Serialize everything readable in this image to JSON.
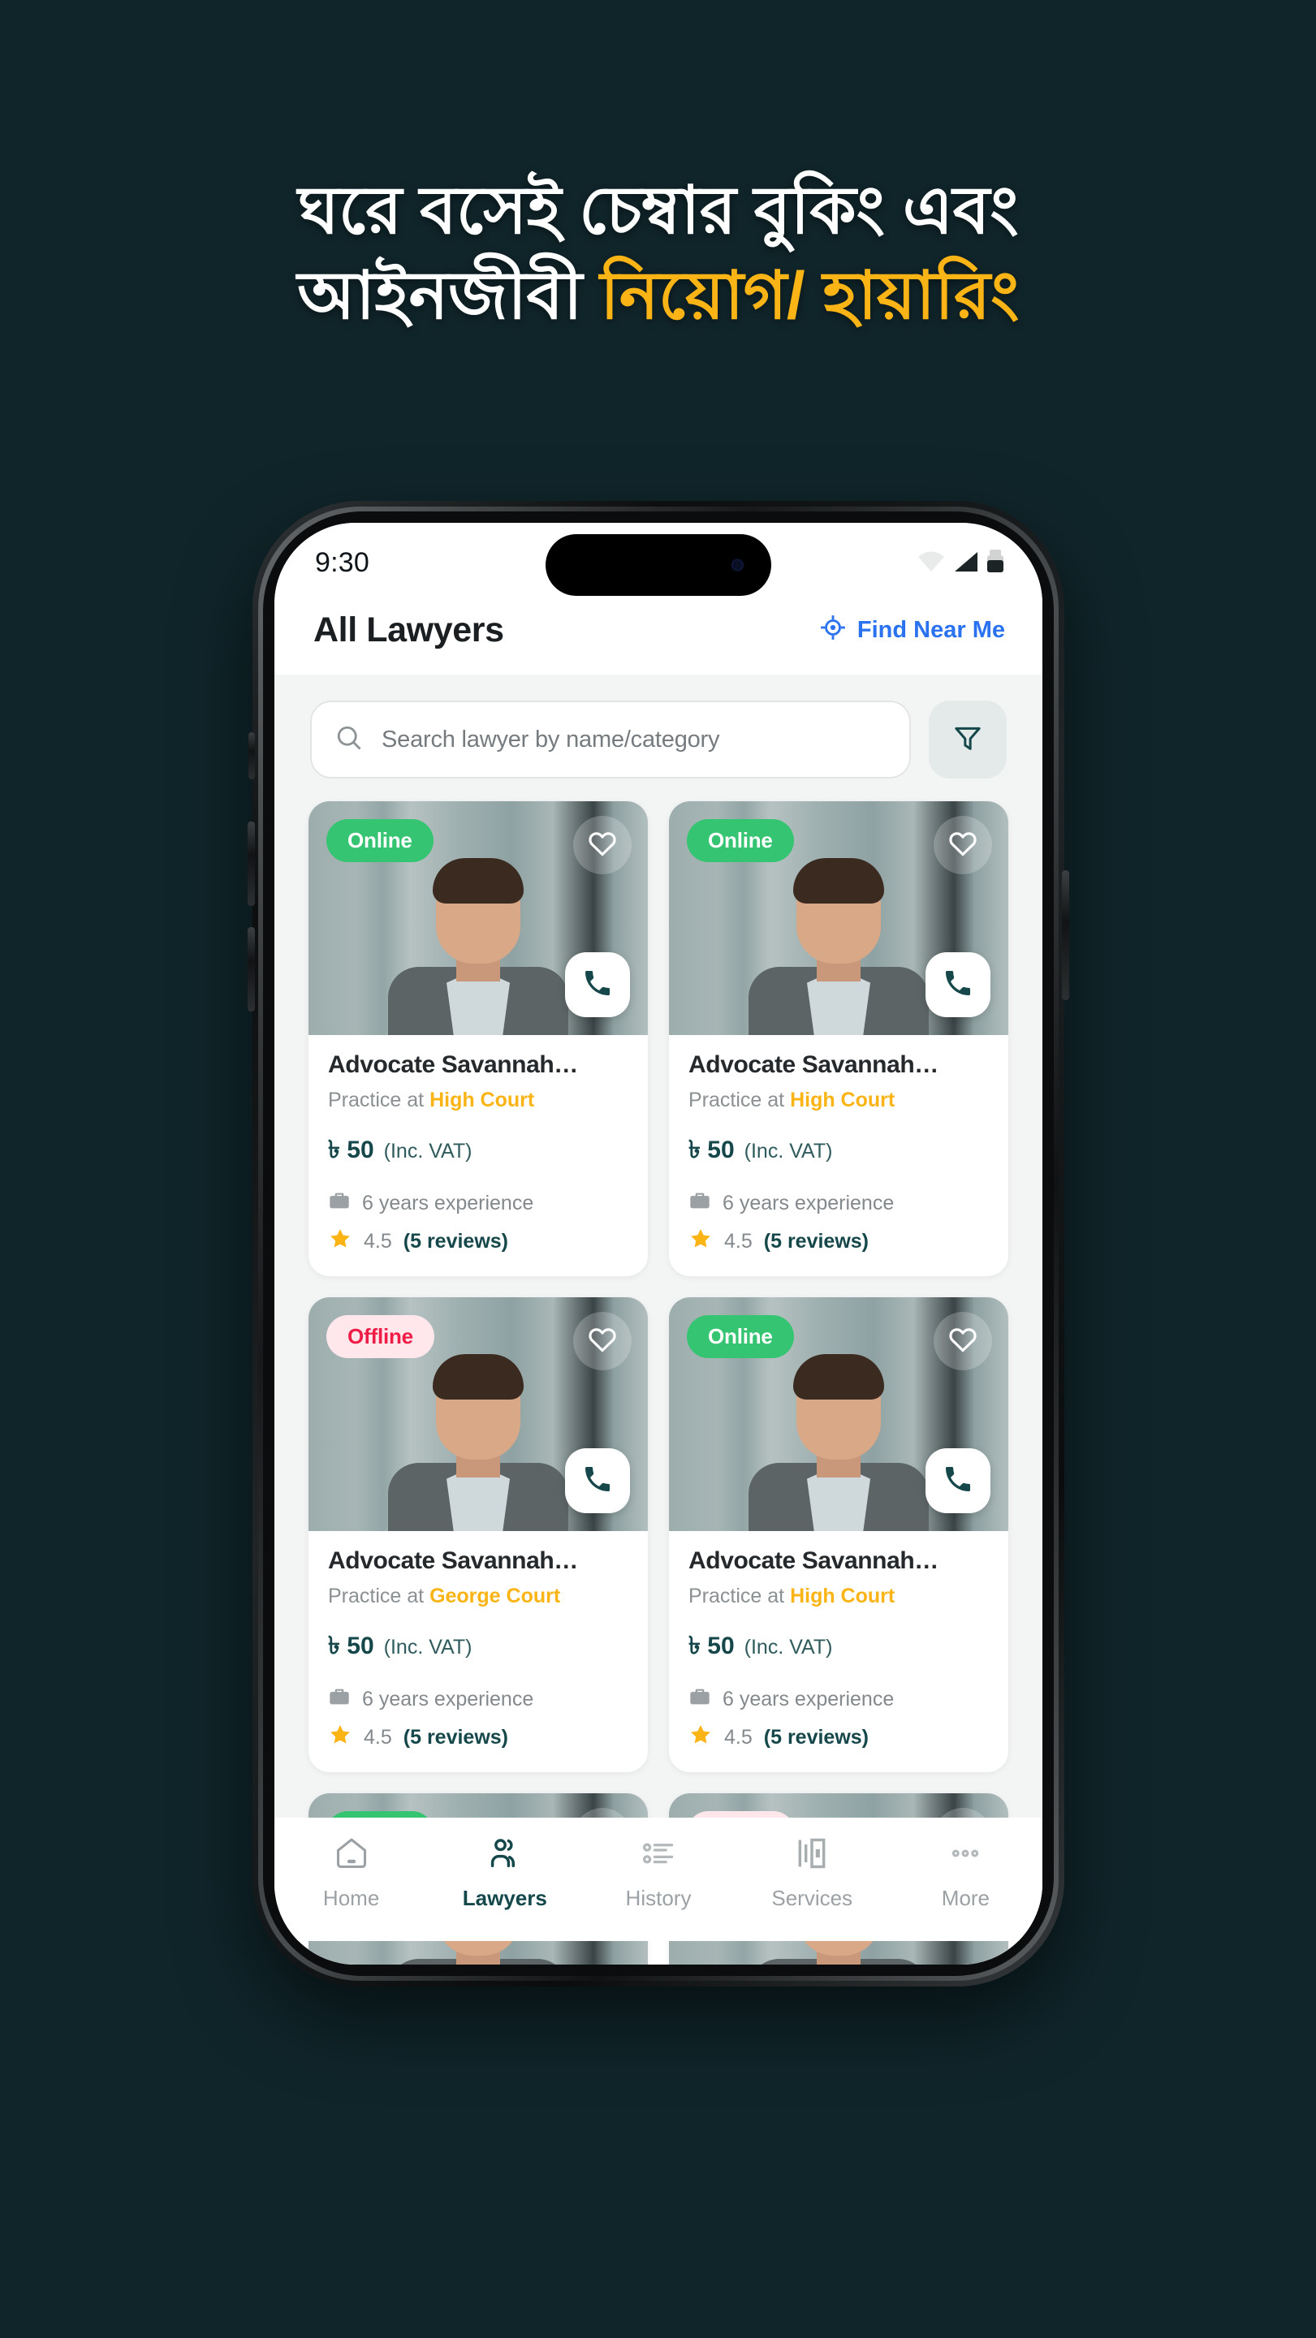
{
  "theme": {
    "background": "#10252a",
    "accent_orange": "#fbb416",
    "accent_blue": "#2a72f0",
    "accent_teal": "#16474a",
    "online_green": "#35c471",
    "offline_red": "#ef1d45",
    "page_bg": "#f3f4f4"
  },
  "headline": {
    "line1": "ঘরে বসেই চেম্বার বুকিং এবং",
    "line2_plain": "আইনজীবী ",
    "line2_accent": "নিয়োগ/ হায়ারিং"
  },
  "statusbar": {
    "time": "9:30",
    "icons": [
      "wifi-icon",
      "cellular-signal-icon",
      "battery-icon"
    ]
  },
  "header": {
    "title": "All Lawyers",
    "find_near_label": "Find Near Me",
    "find_near_icon": "location-crosshair-icon"
  },
  "search": {
    "placeholder": "Search lawyer by name/category",
    "value": "",
    "search_icon": "search-icon",
    "filter_icon": "filter-funnel-icon"
  },
  "cards": [
    {
      "status": "Online",
      "status_type": "online",
      "name": "Advocate Savannah…",
      "practice_prefix": "Practice at ",
      "court": "High Court",
      "price": "৳ 50",
      "price_note": "(Inc. VAT)",
      "experience": "6 years experience",
      "rating": "4.5",
      "reviews": "(5 reviews)"
    },
    {
      "status": "Online",
      "status_type": "online",
      "name": "Advocate Savannah…",
      "practice_prefix": "Practice at ",
      "court": "High Court",
      "price": "৳ 50",
      "price_note": "(Inc. VAT)",
      "experience": "6 years experience",
      "rating": "4.5",
      "reviews": "(5 reviews)"
    },
    {
      "status": "Offline",
      "status_type": "offline",
      "name": "Advocate Savannah…",
      "practice_prefix": "Practice at ",
      "court": "George Court",
      "price": "৳ 50",
      "price_note": "(Inc. VAT)",
      "experience": "6 years experience",
      "rating": "4.5",
      "reviews": "(5 reviews)"
    },
    {
      "status": "Online",
      "status_type": "online",
      "name": "Advocate Savannah…",
      "practice_prefix": "Practice at ",
      "court": "High Court",
      "price": "৳ 50",
      "price_note": "(Inc. VAT)",
      "experience": "6 years experience",
      "rating": "4.5",
      "reviews": "(5 reviews)"
    },
    {
      "status": "Online",
      "status_type": "online",
      "name": "",
      "practice_prefix": "",
      "court": "",
      "price": "",
      "price_note": "",
      "experience": "",
      "rating": "",
      "reviews": ""
    },
    {
      "status": "Offline",
      "status_type": "offline",
      "name": "",
      "practice_prefix": "",
      "court": "",
      "price": "",
      "price_note": "",
      "experience": "",
      "rating": "",
      "reviews": ""
    }
  ],
  "bottom_nav": {
    "items": [
      {
        "label": "Home",
        "icon": "home-icon",
        "active": false
      },
      {
        "label": "Lawyers",
        "icon": "people-icon",
        "active": true
      },
      {
        "label": "History",
        "icon": "list-icon",
        "active": false
      },
      {
        "label": "Services",
        "icon": "services-icon",
        "active": false
      },
      {
        "label": "More",
        "icon": "more-dots-icon",
        "active": false
      }
    ]
  }
}
